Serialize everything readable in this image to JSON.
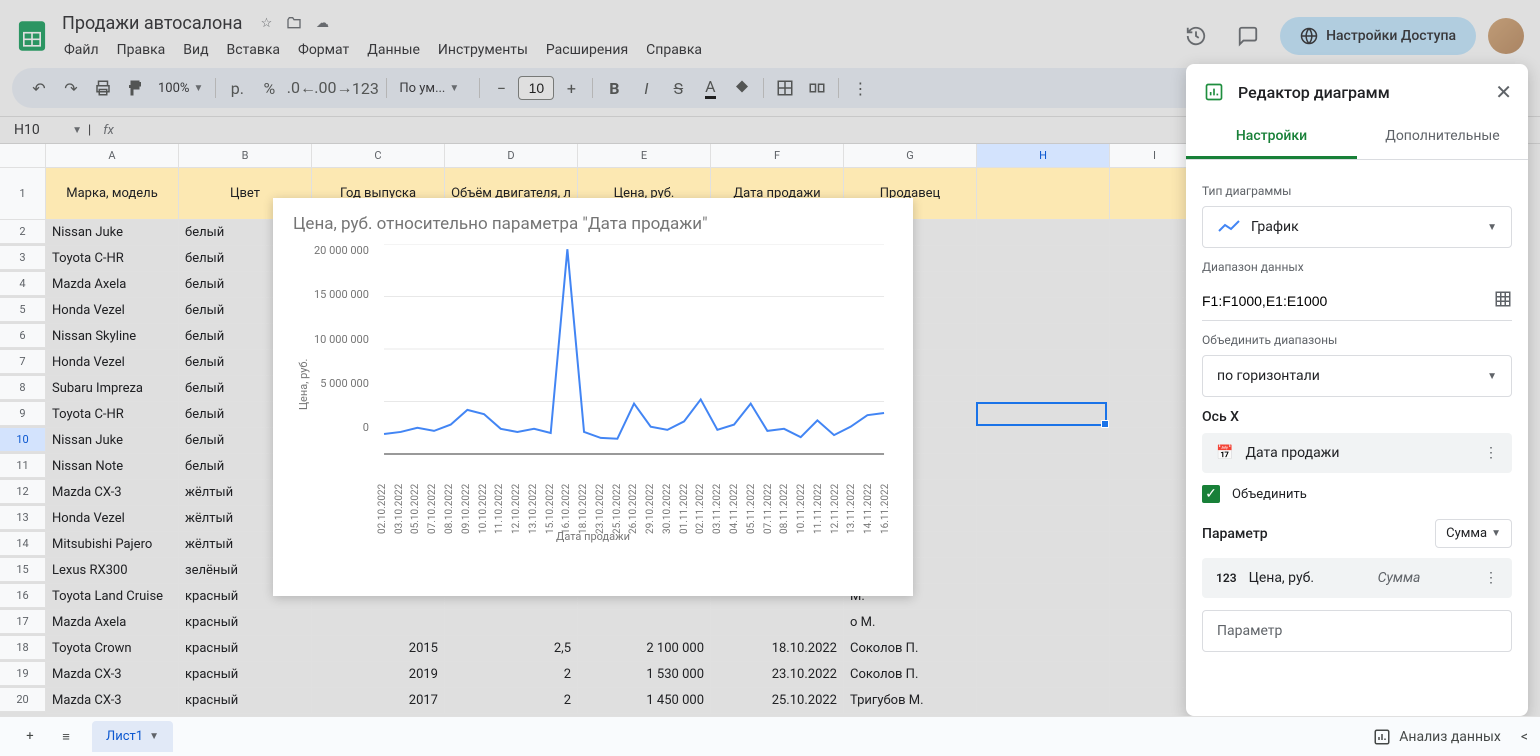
{
  "doc_title": "Продажи автосалона",
  "menu": [
    "Файл",
    "Правка",
    "Вид",
    "Вставка",
    "Формат",
    "Данные",
    "Инструменты",
    "Расширения",
    "Справка"
  ],
  "share_label": "Настройки Доступа",
  "toolbar": {
    "zoom": "100%",
    "currency": "р.",
    "font": "По ум...",
    "font_size": "10"
  },
  "cell_ref": "H10",
  "columns": [
    "A",
    "B",
    "C",
    "D",
    "E",
    "F",
    "G",
    "H",
    "I"
  ],
  "headers": [
    "Марка, модель",
    "Цвет",
    "Год выпуска",
    "Объём двигателя, л",
    "Цена, руб.",
    "Дата продажи",
    "Продавец"
  ],
  "rows": [
    {
      "n": 2,
      "a": "Nissan Juke",
      "b": "белый",
      "g": "П."
    },
    {
      "n": 3,
      "a": "Toyota C-HR",
      "b": "белый",
      "g": "П."
    },
    {
      "n": 4,
      "a": "Mazda Axela",
      "b": "белый",
      "g": "а М."
    },
    {
      "n": 5,
      "a": "Honda Vezel",
      "b": "белый",
      "g": "П."
    },
    {
      "n": 6,
      "a": "Nissan Skyline",
      "b": "белый",
      "g": "а М."
    },
    {
      "n": 7,
      "a": "Honda Vezel",
      "b": "белый",
      "g": "П."
    },
    {
      "n": 8,
      "a": "Subaru Impreza",
      "b": "белый",
      "g": "Г."
    },
    {
      "n": 9,
      "a": "Toyota C-HR",
      "b": "белый",
      "g": "а Г."
    },
    {
      "n": 10,
      "a": "Nissan Juke",
      "b": "белый",
      "g": "П."
    },
    {
      "n": 11,
      "a": "Nissan Note",
      "b": "белый",
      "g": "а Г."
    },
    {
      "n": 12,
      "a": "Mazda CX-3",
      "b": "жёлтый",
      "g": "М."
    },
    {
      "n": 13,
      "a": "Honda Vezel",
      "b": "жёлтый",
      "g": "П."
    },
    {
      "n": 14,
      "a": "Mitsubishi Pajero",
      "b": "жёлтый",
      "g": "М."
    },
    {
      "n": 15,
      "a": "Lexus RX300",
      "b": "зелёный",
      "g": "а Г."
    },
    {
      "n": 16,
      "a": "Toyota Land Cruise",
      "b": "красный",
      "g": "М."
    },
    {
      "n": 17,
      "a": "Mazda Axela",
      "b": "красный",
      "g": "о М."
    },
    {
      "n": 18,
      "a": "Toyota Crown",
      "b": "красный",
      "c": "2015",
      "d": "2,5",
      "e": "2 100 000",
      "f": "18.10.2022",
      "g": "Соколов П."
    },
    {
      "n": 19,
      "a": "Mazda CX-3",
      "b": "красный",
      "c": "2019",
      "d": "2",
      "e": "1 530 000",
      "f": "23.10.2022",
      "g": "Соколов П."
    },
    {
      "n": 20,
      "a": "Mazda CX-3",
      "b": "красный",
      "c": "2017",
      "d": "2",
      "e": "1 450 000",
      "f": "25.10.2022",
      "g": "Тригубов М."
    }
  ],
  "chart_data": {
    "type": "line",
    "title": "Цена, руб. относительно параметра \"Дата продажи\"",
    "xlabel": "Дата продажи",
    "ylabel": "Цена, руб.",
    "ylim": [
      0,
      20000000
    ],
    "yticks": [
      "0",
      "5 000 000",
      "10 000 000",
      "15 000 000",
      "20 000 000"
    ],
    "categories": [
      "02.10.2022",
      "03.10.2022",
      "05.10.2022",
      "07.10.2022",
      "08.10.2022",
      "09.10.2022",
      "10.10.2022",
      "11.10.2022",
      "12.10.2022",
      "13.10.2022",
      "15.10.2022",
      "16.10.2022",
      "18.10.2022",
      "23.10.2022",
      "25.10.2022",
      "26.10.2022",
      "29.10.2022",
      "30.10.2022",
      "01.11.2022",
      "02.11.2022",
      "03.11.2022",
      "04.11.2022",
      "05.11.2022",
      "07.11.2022",
      "08.11.2022",
      "10.11.2022",
      "11.11.2022",
      "12.11.2022",
      "13.11.2022",
      "14.11.2022",
      "16.11.2022"
    ],
    "values": [
      1900000,
      2100000,
      2500000,
      2200000,
      2800000,
      4200000,
      3800000,
      2400000,
      2100000,
      2400000,
      2000000,
      19500000,
      2100000,
      1530000,
      1450000,
      4800000,
      2600000,
      2300000,
      3100000,
      5200000,
      2300000,
      2800000,
      4800000,
      2200000,
      2400000,
      1600000,
      3200000,
      1800000,
      2600000,
      3700000,
      3900000
    ]
  },
  "panel": {
    "title": "Редактор диаграмм",
    "tab1": "Настройки",
    "tab2": "Дополнительные",
    "chart_type_label": "Тип диаграммы",
    "chart_type": "График",
    "range_label": "Диапазон данных",
    "range": "F1:F1000,E1:E1000",
    "merge_label": "Объединить диапазоны",
    "merge_value": "по горизонтали",
    "xaxis_label": "Ось X",
    "xaxis_value": "Дата продажи",
    "combine": "Объединить",
    "param_label": "Параметр",
    "param_agg": "Сумма",
    "param_value": "Цена, руб.",
    "param_value_agg": "Сумма",
    "param_placeholder": "Параметр"
  },
  "sheet_tab": "Лист1",
  "explore": "Анализ данных"
}
